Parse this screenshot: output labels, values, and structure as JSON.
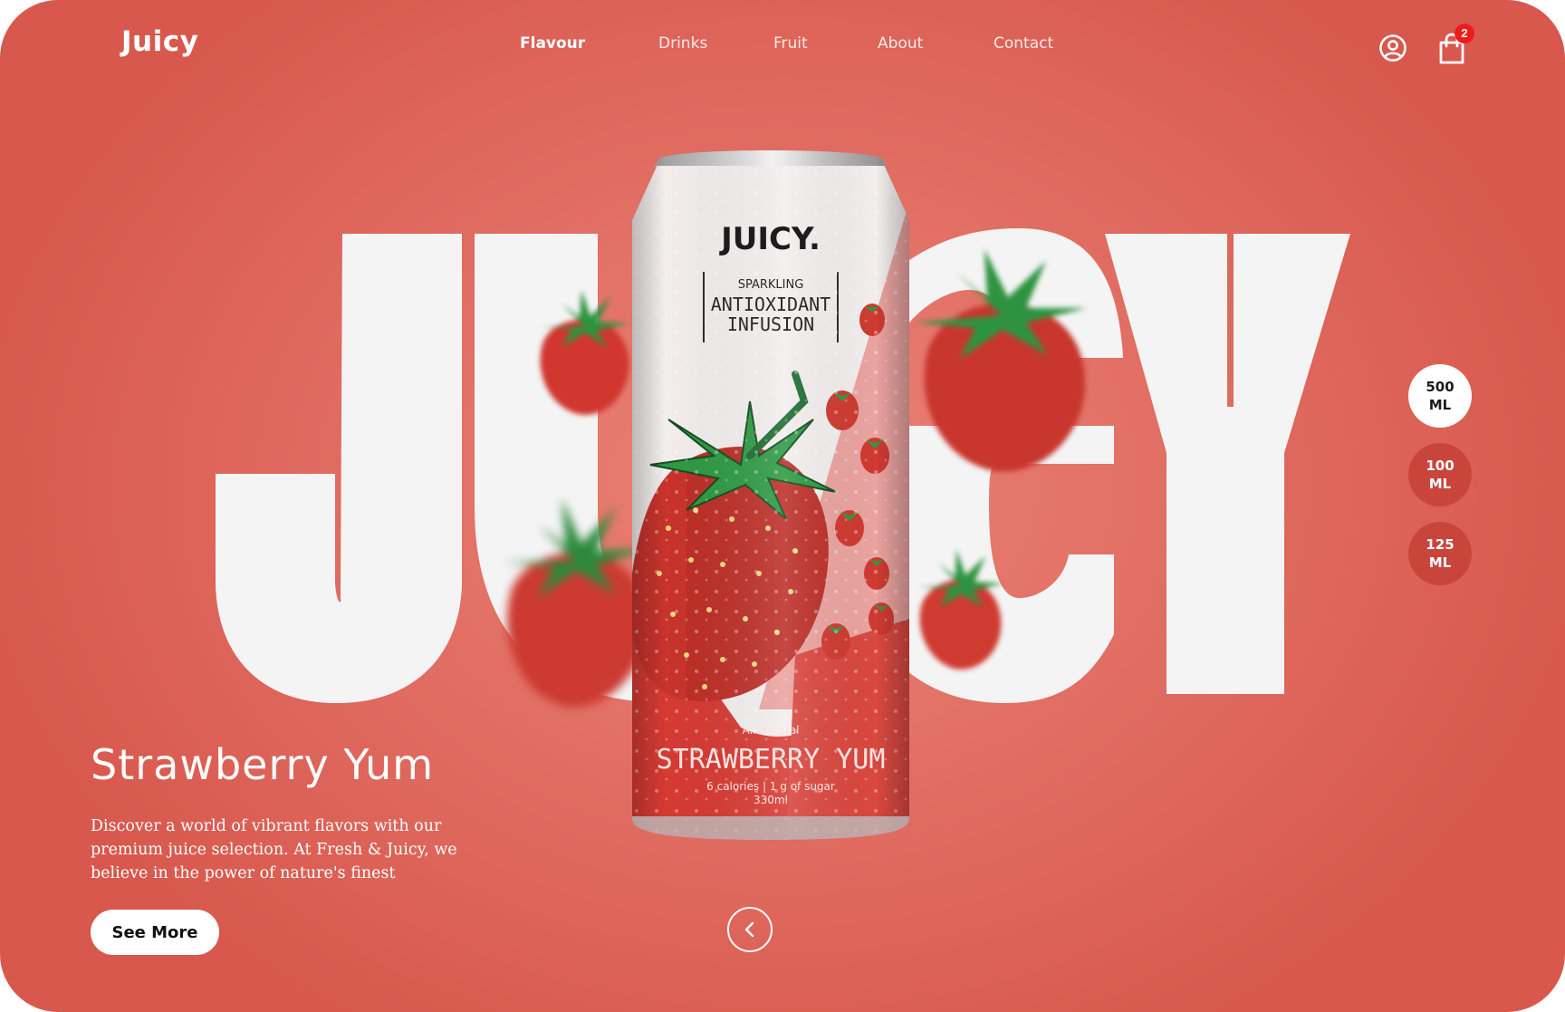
{
  "brand": {
    "logo": "Juicy"
  },
  "nav": {
    "items": [
      {
        "label": "Flavour",
        "active": true
      },
      {
        "label": "Drinks",
        "active": false
      },
      {
        "label": "Fruit",
        "active": false
      },
      {
        "label": "About",
        "active": false
      },
      {
        "label": "Contact",
        "active": false
      }
    ]
  },
  "header_icons": {
    "user": "user-icon",
    "cart": "shopping-bag-icon",
    "cart_count": "2"
  },
  "hero": {
    "big_word": "JUICY",
    "title": "Strawberry Yum",
    "description": "Discover a world of vibrant flavors with our premium juice selection. At Fresh & Juicy, we believe in the power of nature's finest ingredients",
    "cta_label": "See More",
    "prev_icon": "chevron-left-icon"
  },
  "can": {
    "brand": "JUICY.",
    "line1": "SPARKLING",
    "line2": "ANTIOXIDANT",
    "line3": "INFUSION",
    "tag": "All Natural",
    "flavor": "STRAWBERRY YUM",
    "nutrition": "6 calories  |  1 g of sugar",
    "volume": "330ml"
  },
  "sizes": [
    {
      "line1": "500",
      "line2": "ML",
      "selected": true
    },
    {
      "line1": "100",
      "line2": "ML",
      "selected": false
    },
    {
      "line1": "125",
      "line2": "ML",
      "selected": false
    }
  ],
  "colors": {
    "background": "#e27065",
    "background_edge": "#d8584d",
    "letters": "#f4f4f4",
    "size_inactive": "#c9453c",
    "badge": "#ee1b1b",
    "can_red": "#d63a33"
  }
}
